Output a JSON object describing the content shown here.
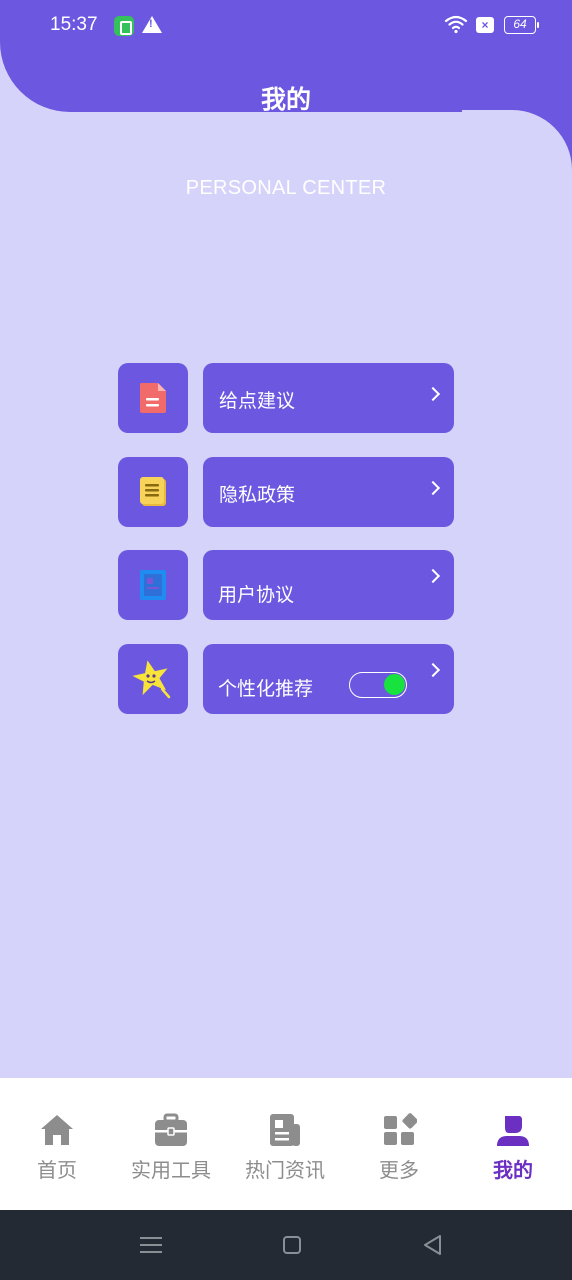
{
  "status_bar": {
    "time": "15:37",
    "battery": "64",
    "icons": [
      "app-notification-icon",
      "warning-icon",
      "wifi-icon",
      "sim-off-icon",
      "battery-icon"
    ]
  },
  "header": {
    "title": "我的",
    "subtitle": "PERSONAL CENTER",
    "accent_color": "#6c57e0",
    "background_color": "#d5d3f9"
  },
  "menu": {
    "items": [
      {
        "label": "给点建议",
        "icon": "document-icon"
      },
      {
        "label": "隐私政策",
        "icon": "notebook-icon"
      },
      {
        "label": "用户协议",
        "icon": "agreement-icon"
      },
      {
        "label": "个性化推荐",
        "icon": "star-icon",
        "toggle": true,
        "toggle_on": true
      }
    ]
  },
  "bottom_nav": {
    "items": [
      {
        "label": "首页",
        "icon": "home-icon"
      },
      {
        "label": "实用工具",
        "icon": "toolbox-icon"
      },
      {
        "label": "热门资讯",
        "icon": "news-icon"
      },
      {
        "label": "更多",
        "icon": "apps-icon"
      },
      {
        "label": "我的",
        "icon": "person-icon",
        "active": true
      }
    ],
    "active_color": "#6b2fc2"
  },
  "system_nav": {
    "icons": [
      "menu-icon",
      "home-square-icon",
      "back-triangle-icon"
    ]
  }
}
